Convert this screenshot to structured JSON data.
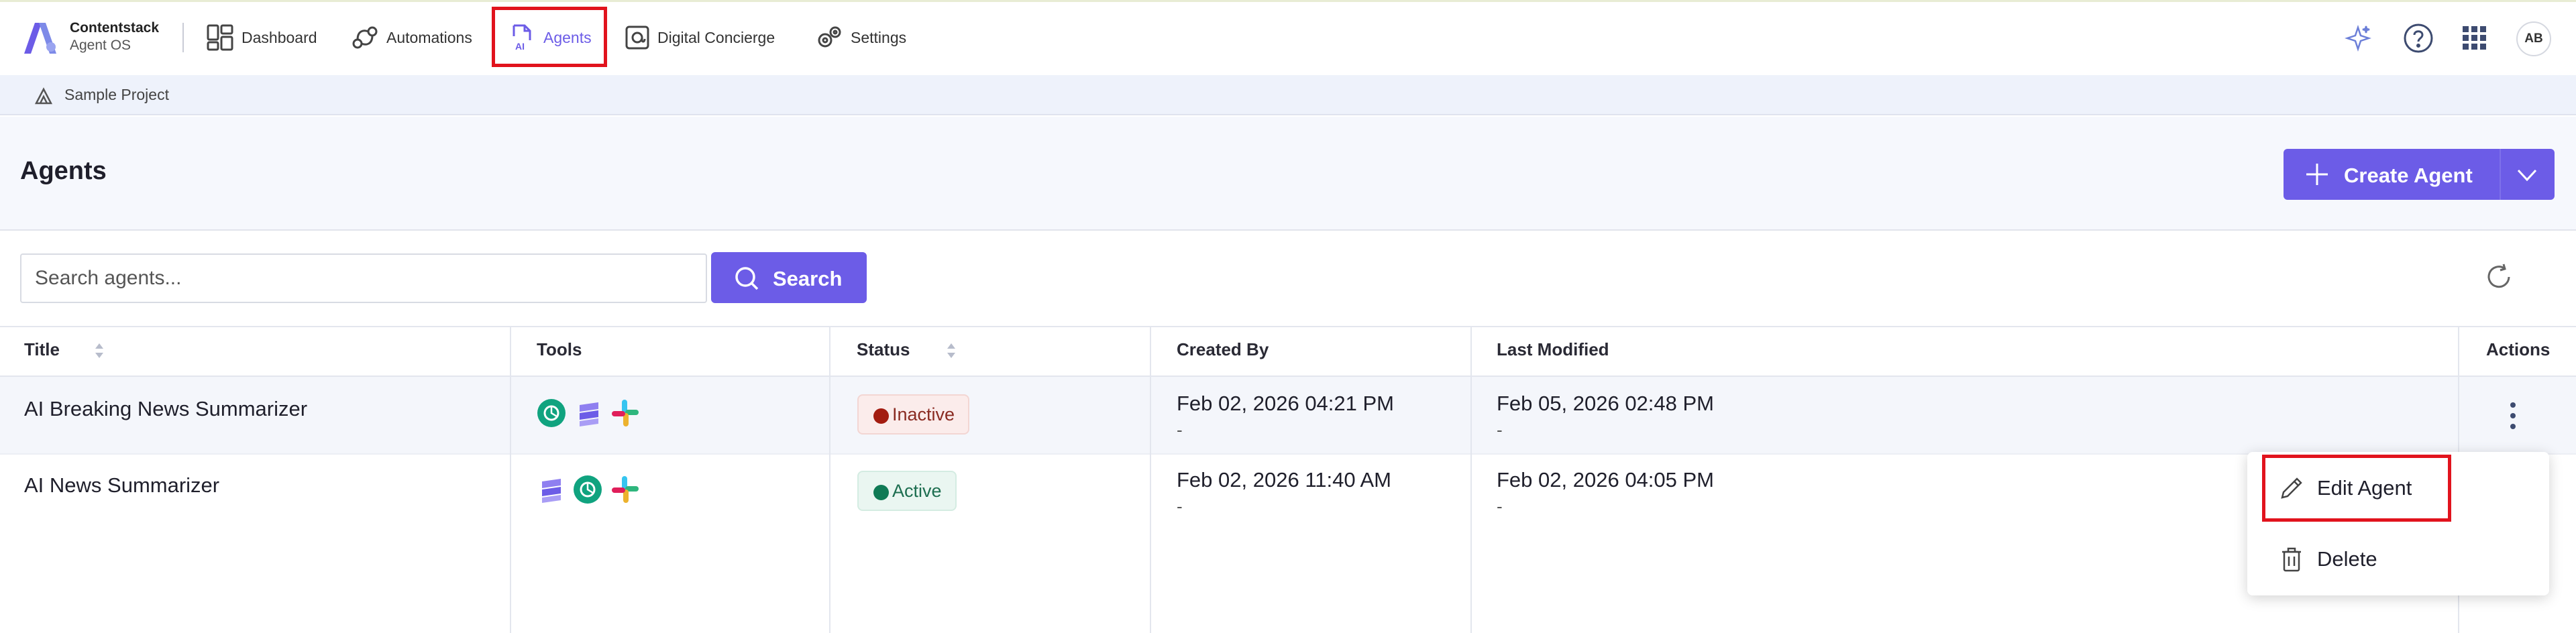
{
  "brand": {
    "name": "Contentstack",
    "sub": "Agent OS"
  },
  "nav": [
    {
      "label": "Dashboard",
      "icon": "dashboard-icon"
    },
    {
      "label": "Automations",
      "icon": "automations-icon"
    },
    {
      "label": "Agents",
      "icon": "agents-ai-icon",
      "active": true
    },
    {
      "label": "Digital Concierge",
      "icon": "concierge-icon"
    },
    {
      "label": "Settings",
      "icon": "gear-icon"
    }
  ],
  "top_right": {
    "avatar": "AB",
    "icons": [
      "sparkle-icon",
      "help-icon",
      "app-grid-icon"
    ]
  },
  "breadcrumb": {
    "project": "Sample Project"
  },
  "page": {
    "title": "Agents",
    "create_label": "Create Agent"
  },
  "search": {
    "placeholder": "Search agents...",
    "button": "Search"
  },
  "table": {
    "headers": {
      "title": "Title",
      "tools": "Tools",
      "status": "Status",
      "created_by": "Created By",
      "last_modified": "Last Modified",
      "actions": "Actions"
    },
    "rows": [
      {
        "title": "AI Breaking News Summarizer",
        "tools": [
          "openai",
          "contentstack",
          "slack"
        ],
        "status": "Inactive",
        "created": "Feb 02, 2026 04:21 PM",
        "created_sub": "-",
        "modified": "Feb 05, 2026 02:48 PM",
        "modified_sub": "-"
      },
      {
        "title": "AI News Summarizer",
        "tools": [
          "contentstack",
          "openai",
          "slack"
        ],
        "status": "Active",
        "created": "Feb 02, 2026 11:40 AM",
        "created_sub": "-",
        "modified": "Feb 02, 2026 04:05 PM",
        "modified_sub": "-"
      }
    ]
  },
  "menu": {
    "edit": "Edit Agent",
    "delete": "Delete"
  },
  "colors": {
    "accent": "#6c5ce7",
    "highlight": "#e1131d",
    "inactive": "#a31c10",
    "active": "#0f7a55"
  }
}
